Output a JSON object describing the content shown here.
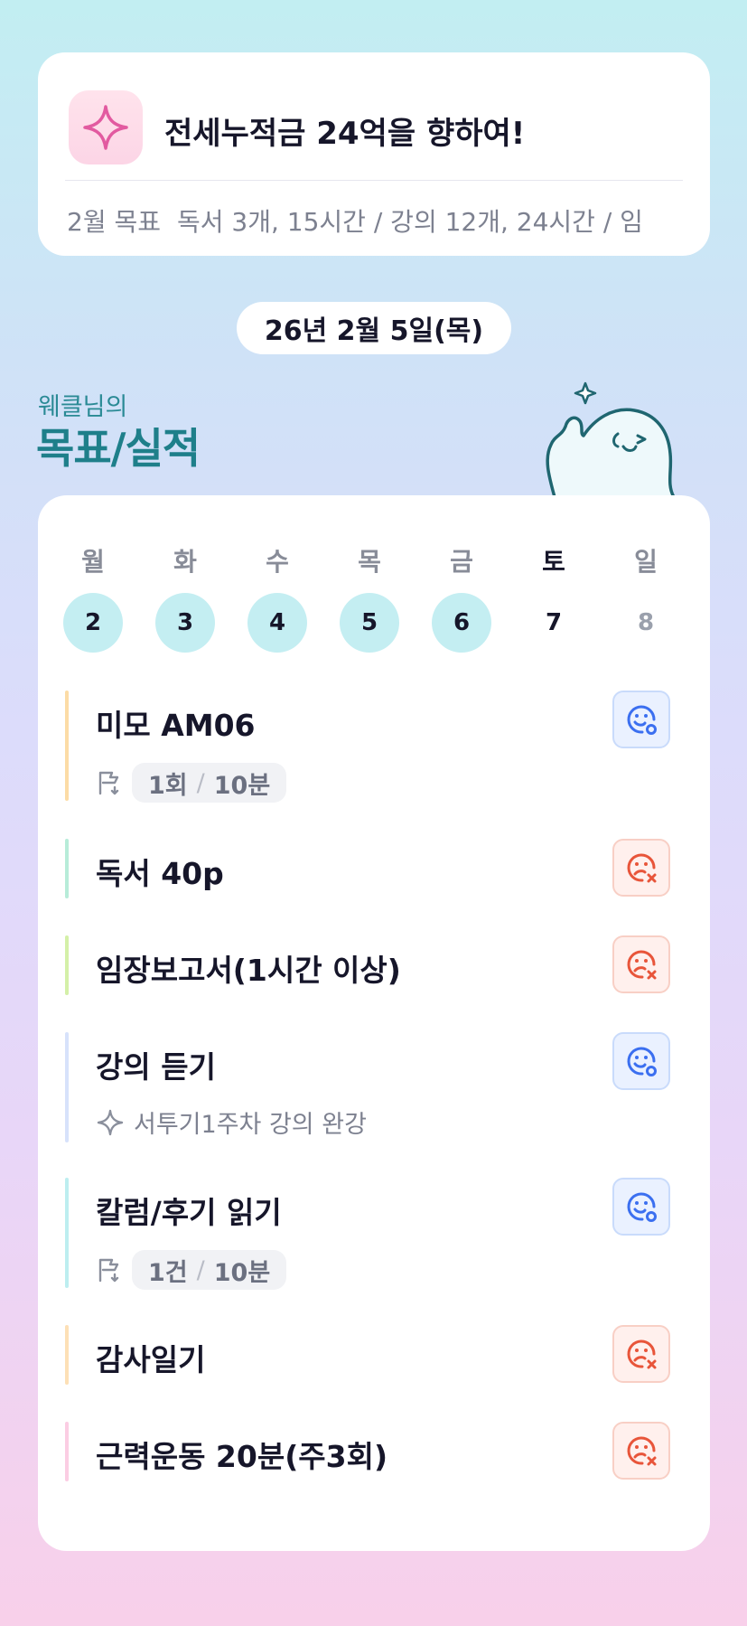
{
  "goal_card": {
    "title": "전세누적금 24억을 향하여!",
    "monthly_label": "2월 목표",
    "monthly_text": "독서 3개, 15시간 / 강의 12개, 24시간 / 임"
  },
  "date": "26년 2월 5일(목)",
  "owner_label": "웨클님의",
  "section_title": "목표/실적",
  "week": [
    {
      "weekday": "월",
      "day": "2",
      "state": "done"
    },
    {
      "weekday": "화",
      "day": "3",
      "state": "done"
    },
    {
      "weekday": "수",
      "day": "4",
      "state": "done"
    },
    {
      "weekday": "목",
      "day": "5",
      "state": "done"
    },
    {
      "weekday": "금",
      "day": "6",
      "state": "done"
    },
    {
      "weekday": "토",
      "day": "7",
      "state": "today"
    },
    {
      "weekday": "일",
      "day": "8",
      "state": "future"
    }
  ],
  "tasks": [
    {
      "title": "미모 AM06",
      "color": "#fcdca6",
      "status": "success",
      "sub_type": "record",
      "count": "1회",
      "duration": "10분"
    },
    {
      "title": "독서 40p",
      "color": "#b7ecd9",
      "status": "fail"
    },
    {
      "title": "임장보고서(1시간 이상)",
      "color": "#d4f0a8",
      "status": "fail"
    },
    {
      "title": "강의 듣기",
      "color": "#d7e2fb",
      "status": "success",
      "sub_type": "note",
      "note": "서투기1주차 강의 완강"
    },
    {
      "title": "칼럼/후기 읽기",
      "color": "#bdeef0",
      "status": "success",
      "sub_type": "record",
      "count": "1건",
      "duration": "10분"
    },
    {
      "title": "감사일기",
      "color": "#fde0b6",
      "status": "fail"
    },
    {
      "title": "근력운동 20분(주3회)",
      "color": "#fbcde3",
      "status": "fail"
    }
  ],
  "colors": {
    "teal_title": "#1e7f8a",
    "success_blue": "#3b6ff0",
    "fail_red": "#e8553a",
    "star_pink": "#e25aa0"
  },
  "icons": {
    "goal": "sparkle-icon",
    "success": "smile-face-icon",
    "fail": "sad-face-x-icon",
    "record": "flag-icon",
    "note": "sparkle-outline-icon"
  }
}
